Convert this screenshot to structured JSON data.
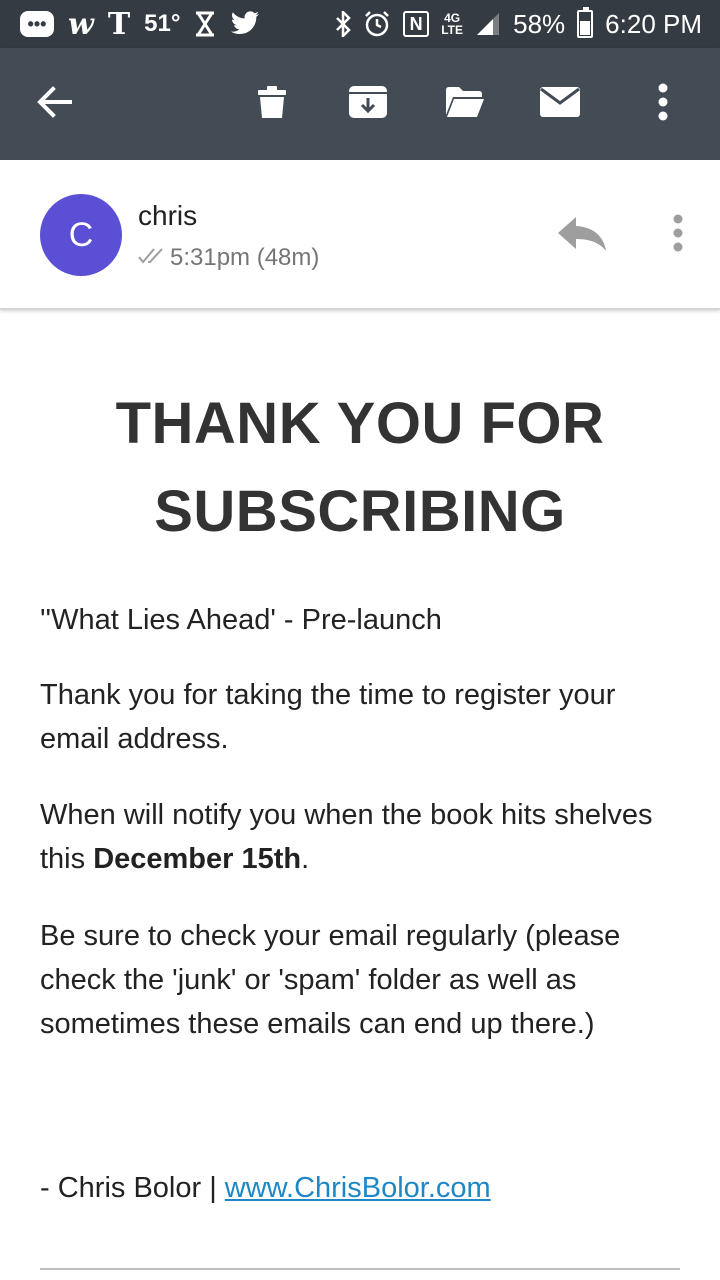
{
  "status_bar": {
    "chat_glyph": "•••",
    "w_glyph": "w",
    "t_glyph": "T",
    "temperature": "51°",
    "network_label": "4G LTE",
    "nfc_glyph": "N",
    "battery": "58%",
    "time": "6:20 PM"
  },
  "toolbar": {
    "icons": [
      "back-arrow-icon",
      "delete-icon",
      "archive-icon",
      "folder-icon",
      "mail-icon",
      "more-vert-icon"
    ]
  },
  "sender": {
    "avatar_letter": "C",
    "avatar_color": "#5b4fd6",
    "name": "chris",
    "time": "5:31pm (48m)"
  },
  "message": {
    "headline": "THANK YOU FOR SUBSCRIBING",
    "subject_line": "''What Lies Ahead' - Pre-launch",
    "para1": "Thank you for taking the time to register your email address.",
    "para2_prefix": "When will notify you when the book hits shelves this ",
    "para2_bold": "December 15th",
    "para2_suffix": ".",
    "para3": "Be sure to check your email regularly (please check the 'junk' or 'spam' folder as well as sometimes these emails can end up there.)",
    "signature_prefix": "- Chris Bolor | ",
    "signature_link": "www.ChrisBolor.com"
  },
  "colors": {
    "status_bar_bg": "#353b42",
    "toolbar_bg": "#434b55",
    "link": "#1e88c7"
  }
}
